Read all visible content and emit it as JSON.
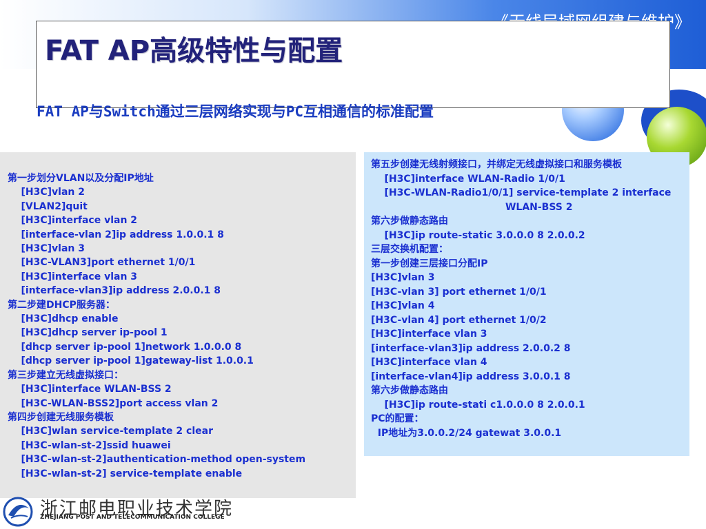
{
  "header": {
    "series_title": "《无线局域网组建与维护》",
    "title": "FAT AP高级特性与配置",
    "subtitle": "FAT AP与Switch通过三层网络实现与PC互相通信的标准配置"
  },
  "left_panel": {
    "lines": [
      "第一步划分VLAN以及分配IP地址",
      "    [H3C]vlan 2",
      "    [VLAN2]quit",
      "    [H3C]interface vlan 2",
      "    [interface-vlan 2]ip address 1.0.0.1 8",
      "    [H3C]vlan 3",
      "    [H3C-VLAN3]port ethernet 1/0/1",
      "    [H3C]interface vlan 3",
      "    [interface-vlan3]ip address 2.0.0.1 8",
      "第二步建DHCP服务器：",
      "    [H3C]dhcp enable",
      "    [H3C]dhcp server ip-pool 1",
      "    [dhcp server ip-pool 1]network 1.0.0.0 8",
      "    [dhcp server ip-pool 1]gateway-list 1.0.0.1",
      "第三步建立无线虚拟接口：",
      "    [H3C]interface WLAN-BSS 2",
      "    [H3C-WLAN-BSS2]port access vlan 2",
      "第四步创建无线服务模板",
      "    [H3C]wlan service-template 2 clear",
      "    [H3C-wlan-st-2]ssid huawei",
      "    [H3C-wlan-st-2]authentication-method open-system",
      "    [H3C-wlan-st-2] service-template enable"
    ]
  },
  "right_panel": {
    "lines": [
      "第五步创建无线射频接口，并绑定无线虚拟接口和服务模板",
      "    [H3C]interface WLAN-Radio 1/0/1",
      "    [H3C-WLAN-Radio1/0/1] service-template 2 interface",
      "                                        WLAN-BSS 2",
      "第六步做静态路由",
      "    [H3C]ip route-static 3.0.0.0 8 2.0.0.2",
      "三层交换机配置：",
      "第一步创建三层接口分配IP",
      "[H3C]vlan 3",
      "[H3C-vlan 3] port ethernet 1/0/1",
      "[H3C]vlan 4",
      "[H3C-vlan 4] port ethernet 1/0/2",
      "[H3C]interface vlan 3",
      "[interface-vlan3]ip address 2.0.0.2 8",
      "[H3C]interface vlan 4",
      "[interface-vlan4]ip address 3.0.0.1 8",
      "第六步做静态路由",
      "    [H3C]ip route-stati c1.0.0.0 8 2.0.0.1",
      "PC的配置：",
      "  IP地址为3.0.0.2/24 gatewat 3.0.0.1"
    ]
  },
  "footer": {
    "college_cn": "浙江邮电职业技术学院",
    "college_en": "ZHEJIANG POST AND TELECOMMUNICATION COLLEGE",
    "logo_icon": "college-emblem-icon"
  },
  "colors": {
    "title": "#22227a",
    "text": "#1a2fd0",
    "left_bg": "#e6e6e6",
    "right_bg": "#cce6fb",
    "accent_blue": "#1e5ed6",
    "accent_green": "#a8d832"
  }
}
